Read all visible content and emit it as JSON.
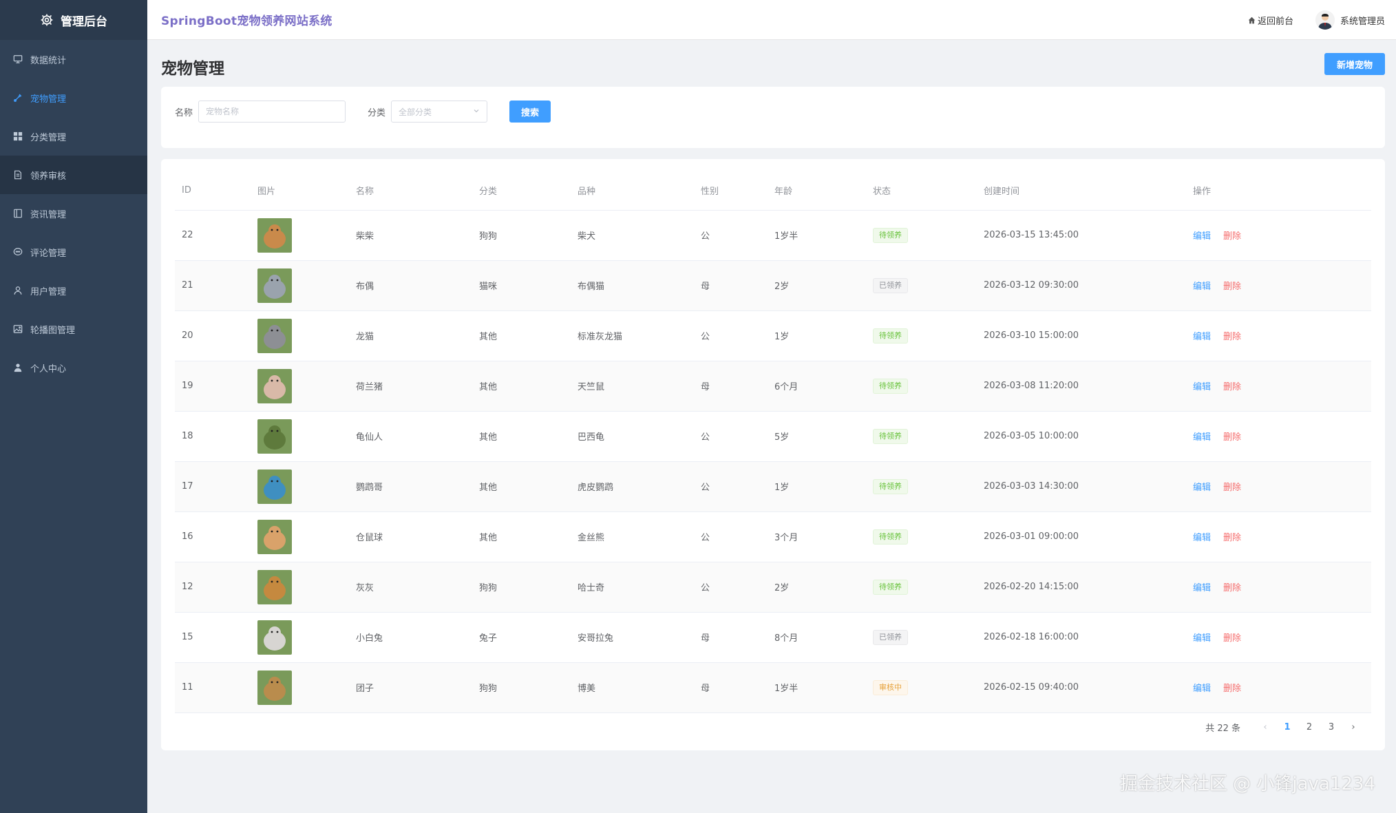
{
  "sidebar": {
    "title": "管理后台",
    "items": [
      {
        "label": "数据统计",
        "icon": "monitor-icon"
      },
      {
        "label": "宠物管理",
        "icon": "paw-icon"
      },
      {
        "label": "分类管理",
        "icon": "grid-icon"
      },
      {
        "label": "领养审核",
        "icon": "document-icon"
      },
      {
        "label": "资讯管理",
        "icon": "news-icon"
      },
      {
        "label": "评论管理",
        "icon": "comment-icon"
      },
      {
        "label": "用户管理",
        "icon": "user-icon"
      },
      {
        "label": "轮播图管理",
        "icon": "image-icon"
      },
      {
        "label": "个人中心",
        "icon": "person-icon"
      }
    ]
  },
  "header": {
    "brand": "SpringBoot宠物领养网站系统",
    "back_label": "返回前台",
    "user_name": "系统管理员"
  },
  "main": {
    "title": "宠物管理",
    "add_label": "新增宠物"
  },
  "filter": {
    "name_label": "名称",
    "name_placeholder": "宠物名称",
    "category_label": "分类",
    "category_value": "全部分类",
    "search_label": "搜索"
  },
  "table": {
    "columns": [
      "ID",
      "图片",
      "名称",
      "分类",
      "品种",
      "性别",
      "年龄",
      "状态",
      "创建时间",
      "操作"
    ],
    "edit_label": "编辑",
    "delete_label": "删除",
    "rows": [
      {
        "id": "22",
        "name": "柴柴",
        "category": "狗狗",
        "breed": "柴犬",
        "gender": "公",
        "age": "1岁半",
        "status": "待领养",
        "status_color": "green",
        "created": "2026-03-15 13:45:00",
        "img_color": "#c98a4b"
      },
      {
        "id": "21",
        "name": "布偶",
        "category": "猫咪",
        "breed": "布偶猫",
        "gender": "母",
        "age": "2岁",
        "status": "已领养",
        "status_color": "gray",
        "created": "2026-03-12 09:30:00",
        "img_color": "#9aa3ad"
      },
      {
        "id": "20",
        "name": "龙猫",
        "category": "其他",
        "breed": "标准灰龙猫",
        "gender": "公",
        "age": "1岁",
        "status": "待领养",
        "status_color": "green",
        "created": "2026-03-10 15:00:00",
        "img_color": "#8d8f94"
      },
      {
        "id": "19",
        "name": "荷兰猪",
        "category": "其他",
        "breed": "天竺鼠",
        "gender": "母",
        "age": "6个月",
        "status": "待领养",
        "status_color": "green",
        "created": "2026-03-08 11:20:00",
        "img_color": "#d9b9a8"
      },
      {
        "id": "18",
        "name": "龟仙人",
        "category": "其他",
        "breed": "巴西龟",
        "gender": "公",
        "age": "5岁",
        "status": "待领养",
        "status_color": "green",
        "created": "2026-03-05 10:00:00",
        "img_color": "#5e7a3c"
      },
      {
        "id": "17",
        "name": "鹦鹉哥",
        "category": "其他",
        "breed": "虎皮鹦鹉",
        "gender": "公",
        "age": "1岁",
        "status": "待领养",
        "status_color": "green",
        "created": "2026-03-03 14:30:00",
        "img_color": "#3f8fc1"
      },
      {
        "id": "16",
        "name": "仓鼠球",
        "category": "其他",
        "breed": "金丝熊",
        "gender": "公",
        "age": "3个月",
        "status": "待领养",
        "status_color": "green",
        "created": "2026-03-01 09:00:00",
        "img_color": "#d9a26a"
      },
      {
        "id": "12",
        "name": "灰灰",
        "category": "狗狗",
        "breed": "哈士奇",
        "gender": "公",
        "age": "2岁",
        "status": "待领养",
        "status_color": "green",
        "created": "2026-02-20 14:15:00",
        "img_color": "#c5893f"
      },
      {
        "id": "15",
        "name": "小白兔",
        "category": "兔子",
        "breed": "安哥拉兔",
        "gender": "母",
        "age": "8个月",
        "status": "已领养",
        "status_color": "gray",
        "created": "2026-02-18 16:00:00",
        "img_color": "#d7d5d2"
      },
      {
        "id": "11",
        "name": "团子",
        "category": "狗狗",
        "breed": "博美",
        "gender": "母",
        "age": "1岁半",
        "status": "审核中",
        "status_color": "orange",
        "created": "2026-02-15 09:40:00",
        "img_color": "#b98c4d"
      }
    ]
  },
  "pagination": {
    "total_label": "共 22 条",
    "pages": [
      "1",
      "2",
      "3"
    ],
    "current": "1"
  },
  "watermark": "掘金技术社区 @ 小锋java1234"
}
